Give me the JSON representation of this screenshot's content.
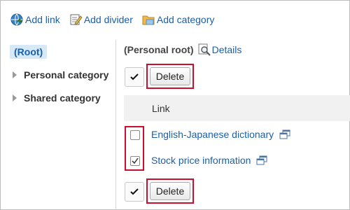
{
  "toolbar": {
    "add_link": "Add link",
    "add_divider": "Add divider",
    "add_category": "Add category"
  },
  "sidebar": {
    "root": "(Root)",
    "items": [
      {
        "label": "Personal category"
      },
      {
        "label": "Shared category"
      }
    ]
  },
  "main": {
    "title": "(Personal root)",
    "details": "Details",
    "delete_label": "Delete",
    "column_header": "Link",
    "links": [
      {
        "label": "English-Japanese dictionary",
        "checked": false
      },
      {
        "label": "Stock price information",
        "checked": true
      }
    ]
  },
  "colors": {
    "link": "#1a5fa8",
    "highlight": "#c8102e",
    "root_bg": "#d7e8f7"
  }
}
